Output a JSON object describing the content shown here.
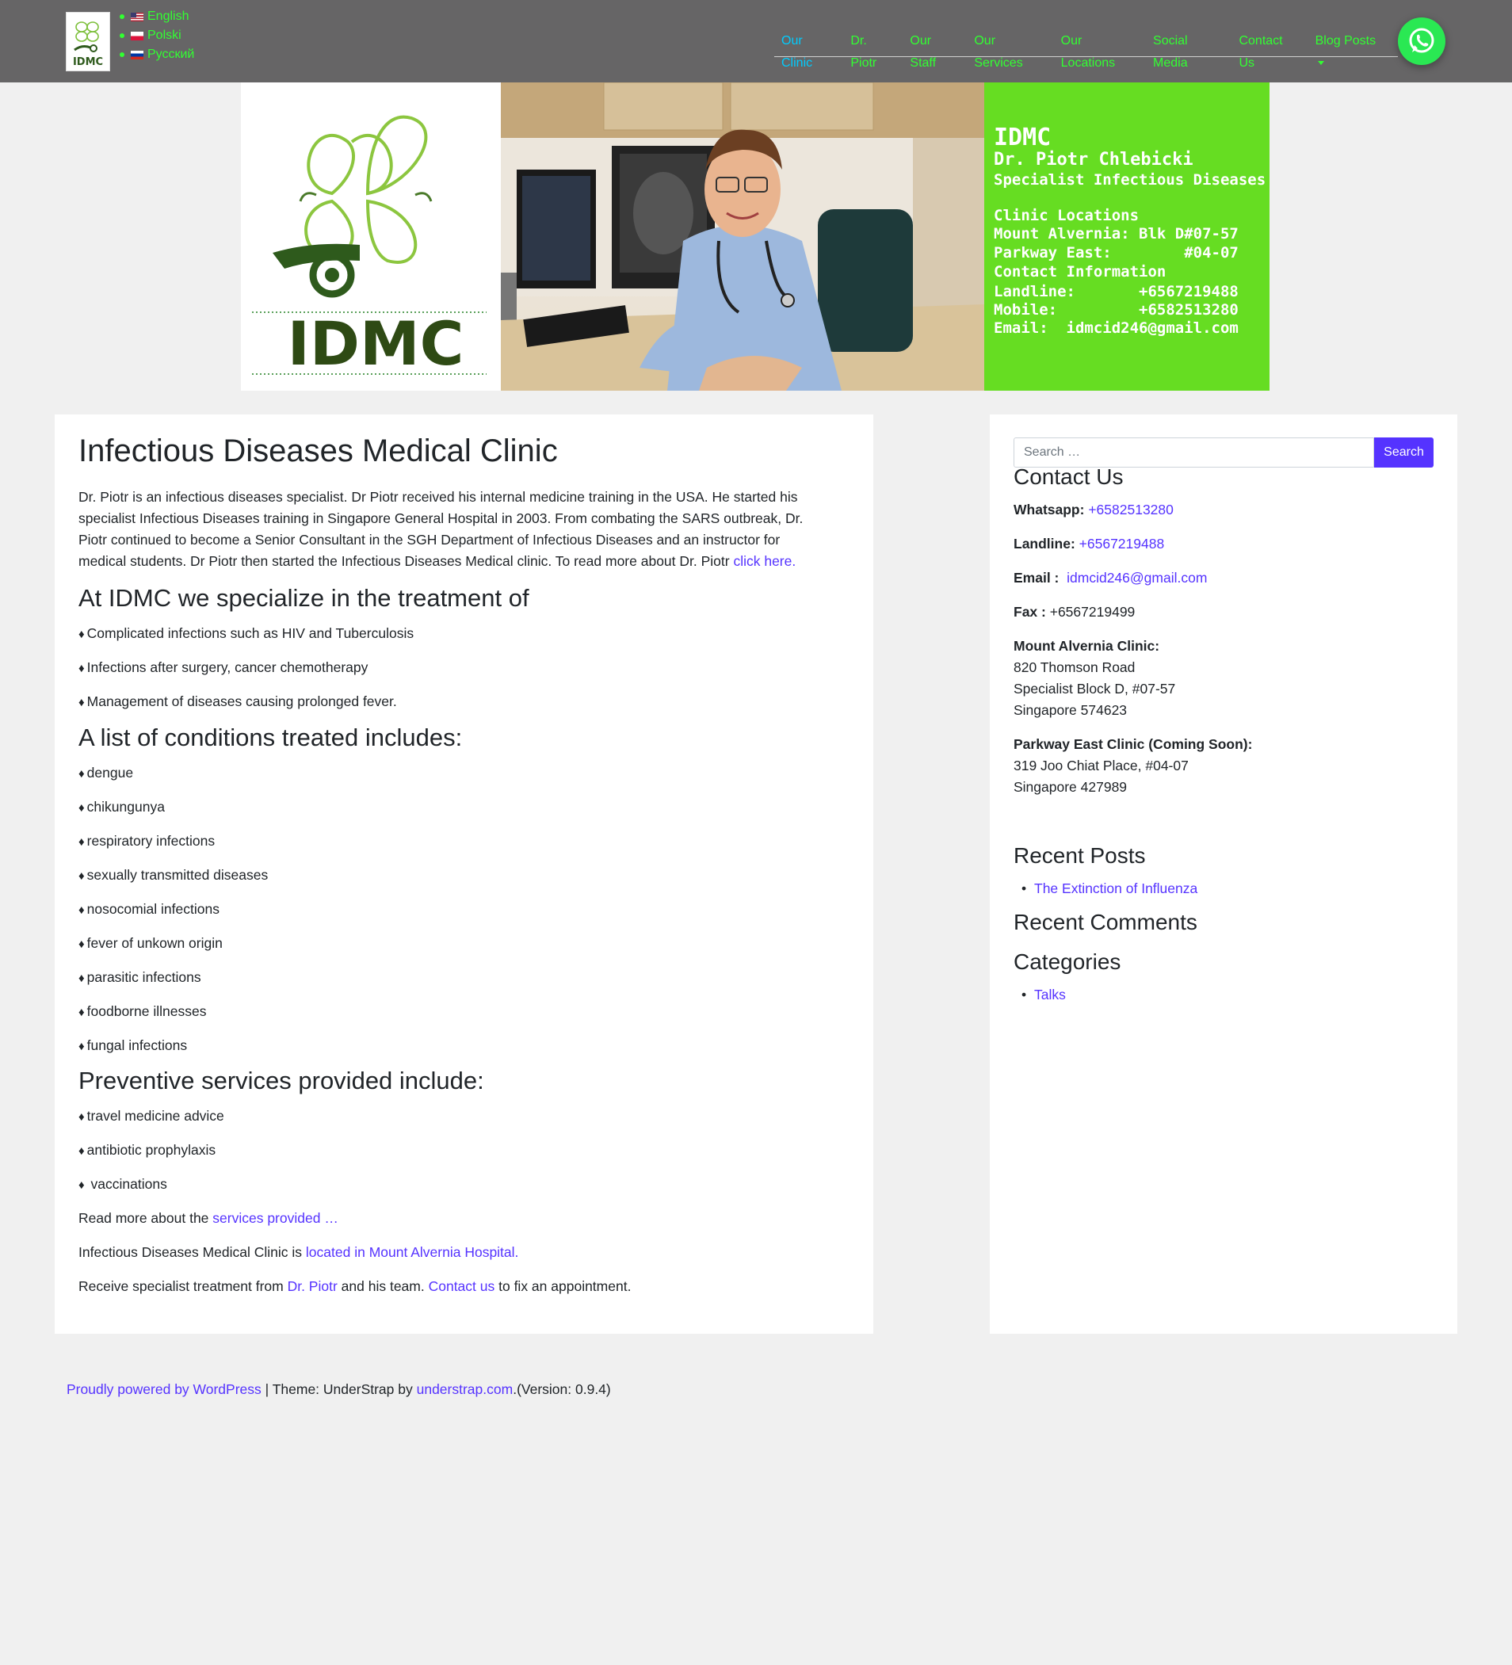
{
  "header": {
    "logo_text": "IDMC",
    "languages": [
      {
        "label": "English",
        "flag": "us-flag"
      },
      {
        "label": "Polski",
        "flag": "pl-flag"
      },
      {
        "label": "Русский",
        "flag": "ru-flag"
      }
    ],
    "nav": [
      {
        "label": "Our Clinic",
        "active": true
      },
      {
        "label": "Dr. Piotr"
      },
      {
        "label": "Our Staff"
      },
      {
        "label": "Our Services"
      },
      {
        "label": "Our Locations"
      },
      {
        "label": "Social Media"
      },
      {
        "label": "Contact Us"
      },
      {
        "label": "Blog Posts",
        "dropdown": true
      }
    ],
    "whatsapp_icon": "whatsapp-icon"
  },
  "banner": {
    "logo_text": "IDMC",
    "info_title": "IDMC",
    "info_name": "Dr. Piotr Chlebicki",
    "info_specialty": "Specialist Infectious Diseases",
    "info_lines": [
      "Clinic Locations",
      "Mount Alvernia: Blk D#07-57",
      "Parkway East:        #04-07",
      "Contact Information",
      "Landline:       +6567219488",
      "Mobile:         +6582513280",
      "Email:  idmcid246@gmail.com"
    ]
  },
  "main": {
    "title": "Infectious Diseases Medical Clinic",
    "intro": "Dr. Piotr is an infectious diseases specialist. Dr Piotr received his internal medicine training in the USA. He started his specialist Infectious Diseases training in Singapore General Hospital in 2003. From combating the SARS outbreak, Dr. Piotr continued to become a Senior Consultant in the SGH Department of Infectious Diseases and an instructor for medical students. Dr Piotr then started the Infectious Diseases Medical clinic. To read more about Dr. Piotr ",
    "intro_link": "click here.",
    "specialize_heading": "At IDMC we specialize in the treatment of",
    "specialize_items": [
      "Complicated infections such as HIV and Tuberculosis",
      "Infections after surgery, cancer chemotherapy",
      "Management of diseases causing prolonged fever."
    ],
    "conditions_heading": "A list of conditions treated includes:",
    "conditions": [
      "dengue",
      "chikungunya",
      "respiratory infections",
      "sexually transmitted diseases",
      "nosocomial infections",
      "fever of unkown origin",
      "parasitic infections",
      "foodborne illnesses",
      "fungal infections"
    ],
    "preventive_heading": "Preventive services provided include:",
    "preventive": [
      "travel medicine advice",
      "antibiotic prophylaxis",
      " vaccinations"
    ],
    "read_more_prefix": "Read more about the ",
    "read_more_link": "services provided …",
    "location_prefix": "Infectious Diseases Medical Clinic is ",
    "location_link": "located in Mount Alvernia Hospital.",
    "receive_prefix": "Receive specialist treatment from ",
    "receive_link1": "Dr. Piotr",
    "receive_mid": " and his team. ",
    "receive_link2": "Contact us",
    "receive_suffix": " to fix an appointment."
  },
  "sidebar": {
    "search_placeholder": "Search …",
    "search_button": "Search",
    "contact_heading": "Contact Us",
    "whatsapp_label": "Whatsapp:",
    "whatsapp_value": "+6582513280",
    "landline_label": "Landline:",
    "landline_value": "+6567219488",
    "email_label": "Email :",
    "email_value": "idmcid246@gmail.com",
    "fax_label": "Fax :",
    "fax_value": "+6567219499",
    "mount_label": "Mount Alvernia Clinic:",
    "mount_lines": [
      "820 Thomson Road",
      "Specialist Block D, #07-57",
      "Singapore 574623"
    ],
    "parkway_label": "Parkway East Clinic (Coming Soon):",
    "parkway_lines": [
      "319 Joo Chiat Place, #04-07",
      "Singapore 427989"
    ],
    "recent_posts_heading": "Recent Posts",
    "recent_posts": [
      "The Extinction of Influenza"
    ],
    "recent_comments_heading": "Recent Comments",
    "categories_heading": "Categories",
    "categories": [
      "Talks"
    ]
  },
  "footer": {
    "powered_link": "Proudly powered by WordPress",
    "theme_text": " | Theme: UnderStrap by ",
    "theme_link": "understrap.com",
    "version_text": ".(Version: 0.9.4)"
  },
  "colors": {
    "navbar_bg": "#666566",
    "nav_link": "#32ff32",
    "nav_active": "#00ccff",
    "link": "#5533ff",
    "banner_green": "#66dd22",
    "whatsapp_green": "#2ae853"
  }
}
